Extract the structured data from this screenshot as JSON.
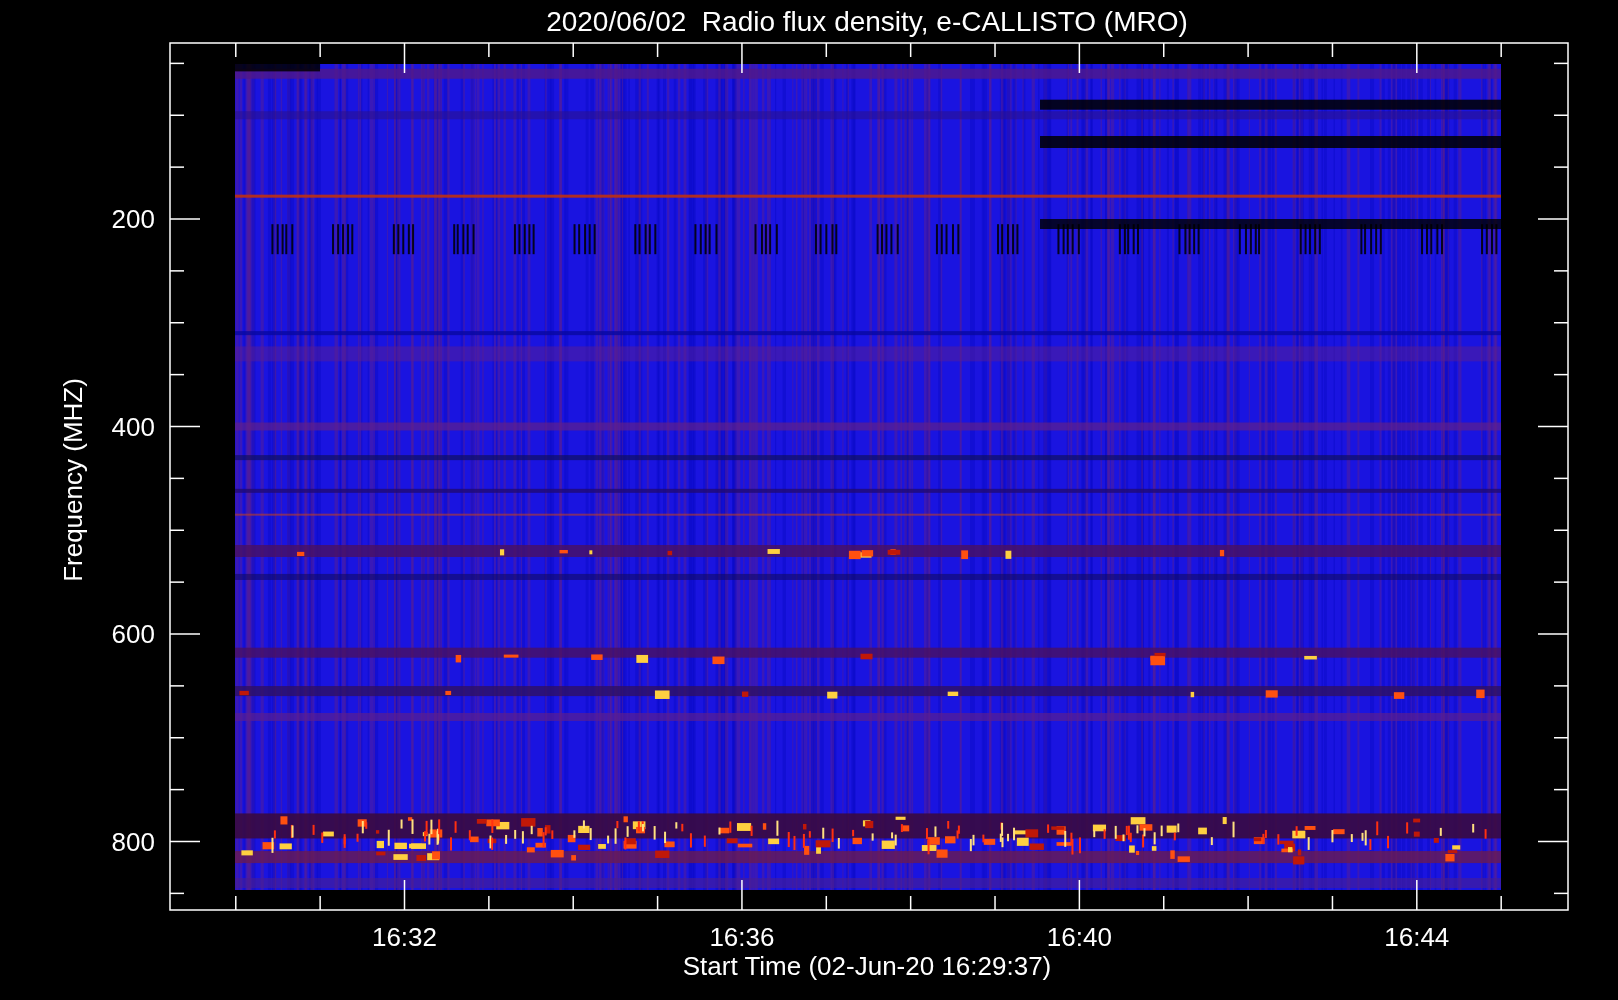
{
  "title": "2020/06/02  Radio flux density, e-CALLISTO (MRO)",
  "y_axis": {
    "label": "Frequency (MHZ)",
    "ticks": [
      "200",
      "400",
      "600",
      "800"
    ]
  },
  "x_axis": {
    "label": "Start Time (02-Jun-20 16:29:37)",
    "ticks": [
      "16:32",
      "16:36",
      "16:40",
      "16:44"
    ]
  }
}
